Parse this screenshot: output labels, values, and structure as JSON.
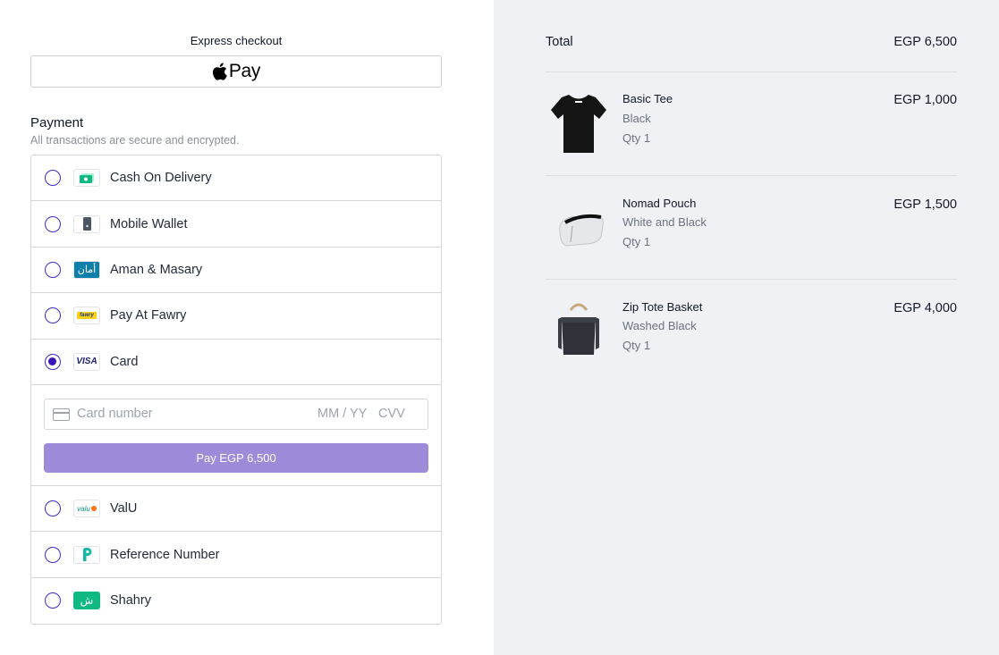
{
  "express": {
    "label": "Express checkout",
    "apple_pay_text": "Pay"
  },
  "payment": {
    "title": "Payment",
    "subtitle": "All transactions are secure and encrypted.",
    "methods": [
      {
        "label": "Cash On Delivery",
        "icon": "cash-icon",
        "selected": false
      },
      {
        "label": "Mobile Wallet",
        "icon": "mobile-wallet-icon",
        "selected": false
      },
      {
        "label": "Aman & Masary",
        "icon": "aman-logo",
        "selected": false
      },
      {
        "label": "Pay At Fawry",
        "icon": "fawry-logo",
        "selected": false
      },
      {
        "label": "Card",
        "icon": "visa-logo",
        "selected": true
      },
      {
        "label": "ValU",
        "icon": "valu-logo",
        "selected": false
      },
      {
        "label": "Reference Number",
        "icon": "reference-number-icon",
        "selected": false
      },
      {
        "label": "Shahry",
        "icon": "shahry-logo",
        "selected": false
      }
    ],
    "card": {
      "number_placeholder": "Card number",
      "expiry_placeholder": "MM / YY",
      "cvv_placeholder": "CVV",
      "pay_button": "Pay EGP 6,500"
    },
    "logo_text": {
      "aman": "أمان",
      "fawry": "fawry",
      "visa": "VISA",
      "valu": "valu",
      "shahry": "ش"
    }
  },
  "summary": {
    "total_label": "Total",
    "total_value": "EGP 6,500",
    "items": [
      {
        "name": "Basic Tee",
        "variant": "Black",
        "qty": "Qty 1",
        "price": "EGP 1,000"
      },
      {
        "name": "Nomad Pouch",
        "variant": "White and Black",
        "qty": "Qty 1",
        "price": "EGP 1,500"
      },
      {
        "name": "Zip Tote Basket",
        "variant": "Washed Black",
        "qty": "Qty 1",
        "price": "EGP 4,000"
      }
    ]
  },
  "colors": {
    "accent": "#3b14b5",
    "pay_button": "#9d8ad9",
    "right_panel_bg": "#f0f1f4"
  }
}
